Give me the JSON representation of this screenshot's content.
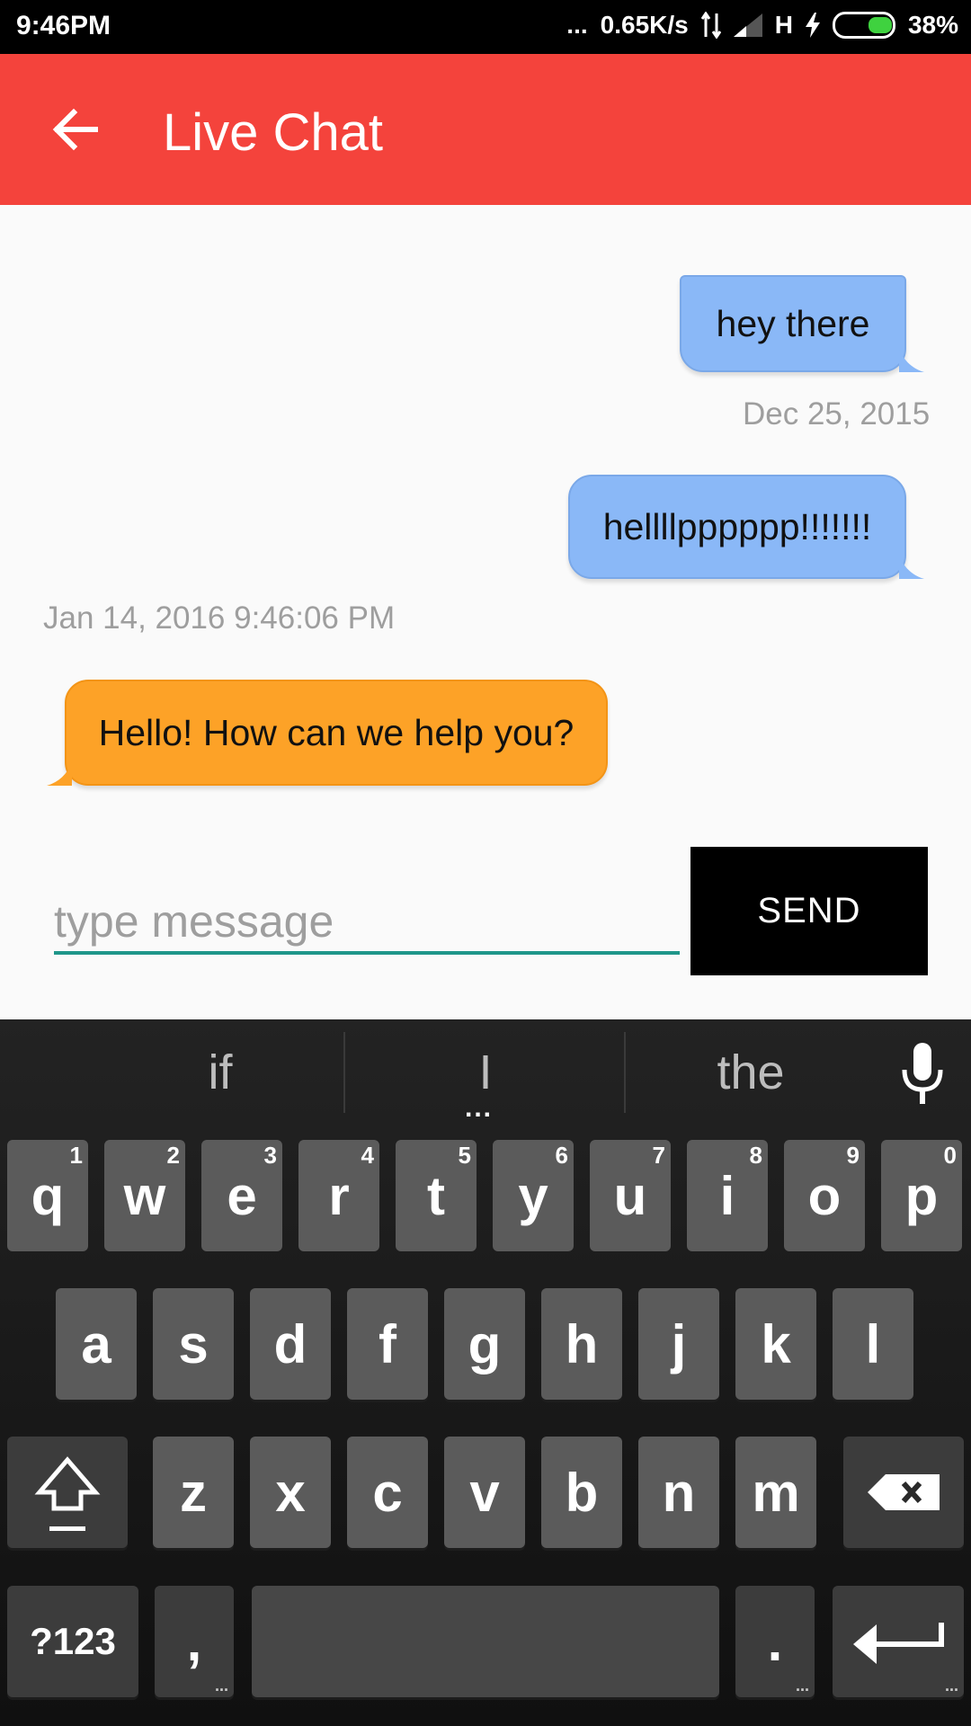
{
  "status_bar": {
    "time": "9:46PM",
    "dots": "...",
    "speed": "0.65K/s",
    "network": "H",
    "battery": "38%"
  },
  "app_bar": {
    "title": "Live Chat"
  },
  "messages": [
    {
      "text": "hey there",
      "direction": "outgoing"
    },
    {
      "timestamp": "Dec 25, 2015"
    },
    {
      "text": "hellllpppppp!!!!!!!",
      "direction": "outgoing"
    },
    {
      "timestamp": "Jan 14, 2016 9:46:06 PM"
    },
    {
      "text": "Hello! How can we help you?",
      "direction": "incoming"
    }
  ],
  "composer": {
    "placeholder": "type message",
    "send_label": "SEND"
  },
  "keyboard": {
    "suggestions": [
      "if",
      "I",
      "the"
    ],
    "suggestion_more": "...",
    "row1": [
      {
        "letter": "q",
        "num": "1"
      },
      {
        "letter": "w",
        "num": "2"
      },
      {
        "letter": "e",
        "num": "3"
      },
      {
        "letter": "r",
        "num": "4"
      },
      {
        "letter": "t",
        "num": "5"
      },
      {
        "letter": "y",
        "num": "6"
      },
      {
        "letter": "u",
        "num": "7"
      },
      {
        "letter": "i",
        "num": "8"
      },
      {
        "letter": "o",
        "num": "9"
      },
      {
        "letter": "p",
        "num": "0"
      }
    ],
    "row2": [
      "a",
      "s",
      "d",
      "f",
      "g",
      "h",
      "j",
      "k",
      "l"
    ],
    "row3": [
      "z",
      "x",
      "c",
      "v",
      "b",
      "n",
      "m"
    ],
    "symbols_label": "?123",
    "comma": ",",
    "period": ".",
    "key_more": "...",
    "icons": [
      "shift-icon",
      "backspace-icon",
      "enter-icon",
      "mic-icon",
      "back-arrow-icon"
    ]
  },
  "colors": {
    "app_bar": "#f4433c",
    "outgoing_bubble": "#8ab8f7",
    "incoming_bubble": "#fda227",
    "input_accent": "#1f968a"
  }
}
